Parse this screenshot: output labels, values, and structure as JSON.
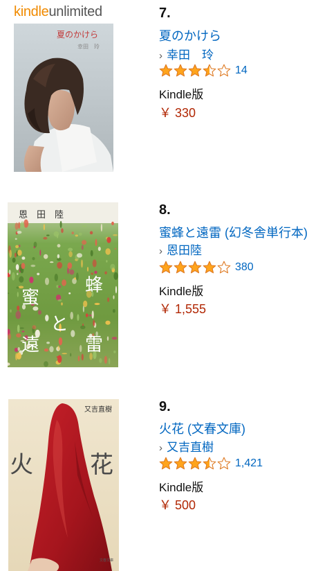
{
  "colors": {
    "link": "#0066c0",
    "price": "#b12704",
    "star_fill": "#ffa41c",
    "star_stroke": "#de7921",
    "kindle_orange": "#f08a00"
  },
  "badge": {
    "kindle": "kindle",
    "unlimited": "unlimited"
  },
  "items": [
    {
      "rank": "7.",
      "title": "夏のかけら",
      "author": "幸田　玲",
      "rating": 3.5,
      "reviews": "14",
      "format": "Kindle版",
      "price": "￥ 330",
      "cover": {
        "title": "夏のかけら",
        "author": "幸田　玲"
      }
    },
    {
      "rank": "8.",
      "title": "蜜蜂と遠雷 (幻冬舎単行本)",
      "author": "恩田陸",
      "rating": 4.0,
      "reviews": "380",
      "format": "Kindle版",
      "price": "￥ 1,555",
      "cover": {
        "author": "恩　田　陸",
        "chars": [
          "蜜",
          "蜂",
          "と",
          "遠",
          "雷"
        ]
      }
    },
    {
      "rank": "9.",
      "title": "火花 (文春文庫)",
      "author": "又吉直樹",
      "rating": 3.5,
      "reviews": "1,421",
      "format": "Kindle版",
      "price": "￥ 500",
      "cover": {
        "author": "又吉直樹",
        "chars": [
          "火",
          "花"
        ],
        "publisher": "文春文庫"
      }
    }
  ]
}
